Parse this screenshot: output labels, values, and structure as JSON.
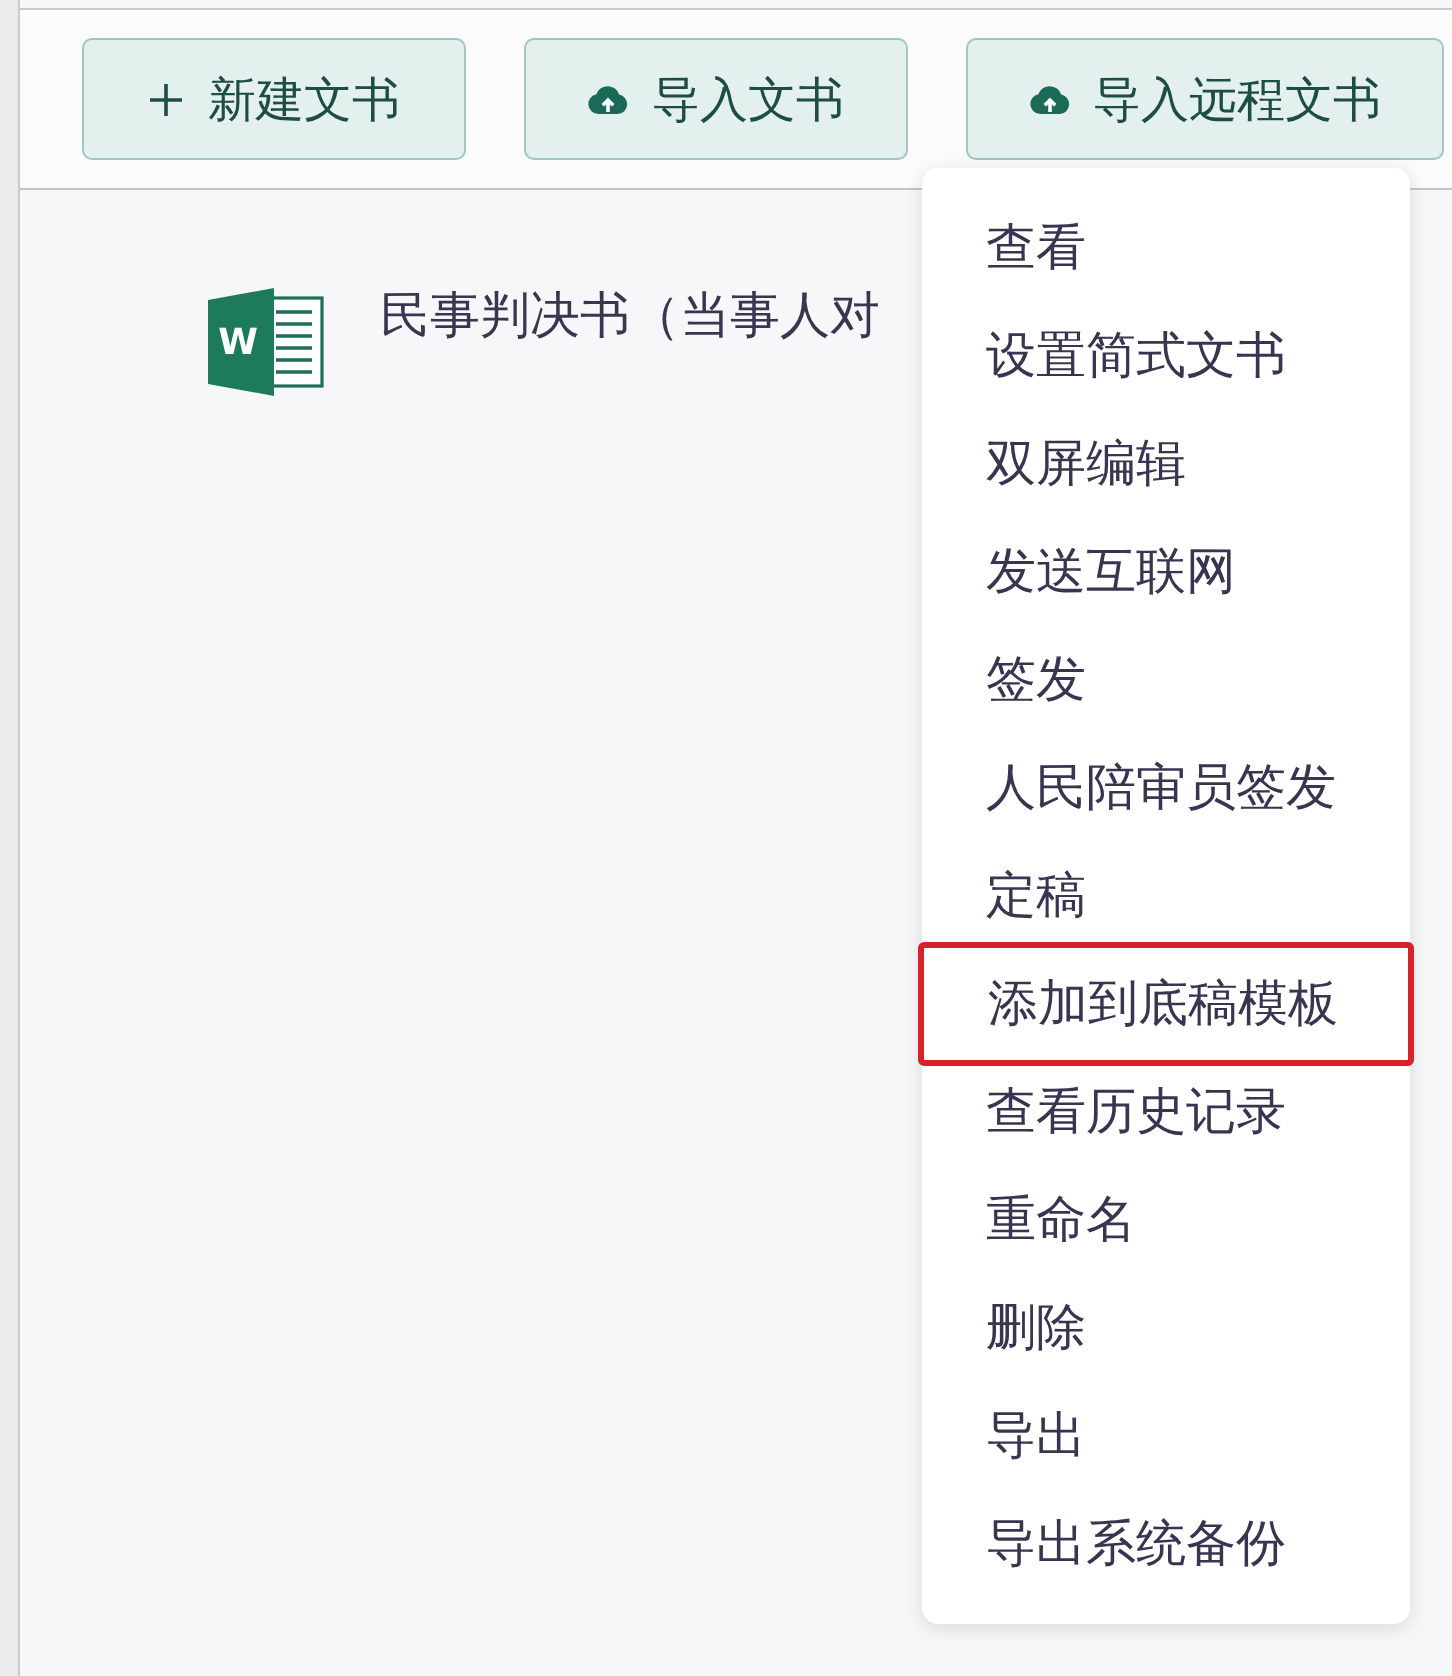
{
  "toolbar": {
    "buttons": [
      {
        "kind": "add",
        "label": "新建文书"
      },
      {
        "kind": "upload",
        "label": "导入文书"
      },
      {
        "kind": "upload",
        "label": "导入远程文书"
      }
    ]
  },
  "documents": [
    {
      "kind": "word",
      "icon_letter": "W",
      "name": "民事判决书（当事人对"
    }
  ],
  "context_menu": {
    "items": [
      {
        "label": "查看",
        "highlighted": false
      },
      {
        "label": "设置简式文书",
        "highlighted": false
      },
      {
        "label": "双屏编辑",
        "highlighted": false
      },
      {
        "label": "发送互联网",
        "highlighted": false
      },
      {
        "label": "签发",
        "highlighted": false
      },
      {
        "label": "人民陪审员签发",
        "highlighted": false
      },
      {
        "label": "定稿",
        "highlighted": false
      },
      {
        "label": "添加到底稿模板",
        "highlighted": true
      },
      {
        "label": "查看历史记录",
        "highlighted": false
      },
      {
        "label": "重命名",
        "highlighted": false
      },
      {
        "label": "删除",
        "highlighted": false
      },
      {
        "label": "导出",
        "highlighted": false
      },
      {
        "label": "导出系统备份",
        "highlighted": false
      }
    ]
  }
}
